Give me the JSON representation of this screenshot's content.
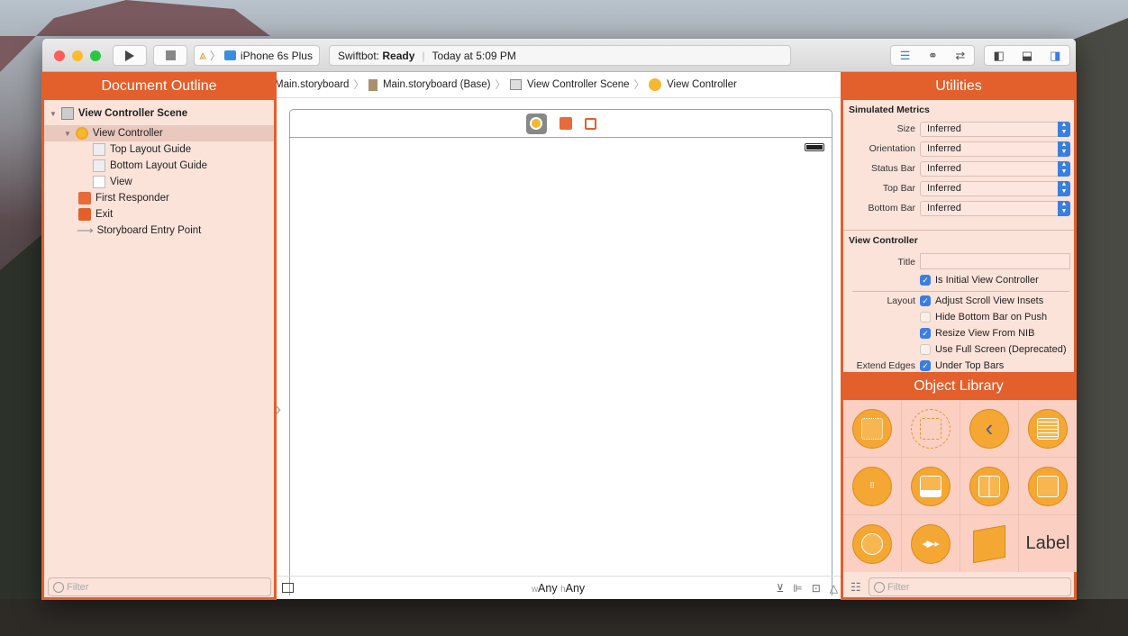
{
  "toolbar": {
    "scheme_device": "iPhone 6s Plus",
    "status_app": "Swiftbot:",
    "status_state": "Ready",
    "status_time": "Today at 5:09 PM"
  },
  "outline": {
    "title": "Document Outline",
    "items": [
      {
        "label": "View Controller Scene",
        "icon": "scene-icon"
      },
      {
        "label": "View Controller",
        "icon": "view-controller-icon"
      },
      {
        "label": "Top Layout Guide",
        "icon": "layout-guide-icon"
      },
      {
        "label": "Bottom Layout Guide",
        "icon": "layout-guide-icon"
      },
      {
        "label": "View",
        "icon": "view-icon"
      },
      {
        "label": "First Responder",
        "icon": "first-responder-icon"
      },
      {
        "label": "Exit",
        "icon": "exit-icon"
      },
      {
        "label": "Storyboard Entry Point",
        "icon": "arrow-right-icon"
      }
    ],
    "filter_placeholder": "Filter"
  },
  "breadcrumb": [
    "Main.storyboard",
    "Main.storyboard (Base)",
    "View Controller Scene",
    "View Controller"
  ],
  "canvas": {
    "w_prefix": "w",
    "w_value": "Any",
    "h_prefix": "h",
    "h_value": "Any"
  },
  "utilities": {
    "title": "Utilities",
    "simulated_metrics": {
      "heading": "Simulated Metrics",
      "rows": [
        {
          "label": "Size",
          "value": "Inferred"
        },
        {
          "label": "Orientation",
          "value": "Inferred"
        },
        {
          "label": "Status Bar",
          "value": "Inferred"
        },
        {
          "label": "Top Bar",
          "value": "Inferred"
        },
        {
          "label": "Bottom Bar",
          "value": "Inferred"
        }
      ]
    },
    "view_controller": {
      "heading": "View Controller",
      "title_label": "Title",
      "title_value": "",
      "initial": {
        "label": "Is Initial View Controller",
        "checked": true
      },
      "layout_label": "Layout",
      "layout": [
        {
          "label": "Adjust Scroll View Insets",
          "checked": true
        },
        {
          "label": "Hide Bottom Bar on Push",
          "checked": false
        },
        {
          "label": "Resize View From NIB",
          "checked": true
        },
        {
          "label": "Use Full Screen (Deprecated)",
          "checked": false
        }
      ],
      "extend_label": "Extend Edges",
      "extend": {
        "label": "Under Top Bars",
        "checked": true
      }
    }
  },
  "library": {
    "title": "Object Library",
    "label_item": "Label",
    "filter_placeholder": "Filter"
  },
  "colors": {
    "accent": "#e35f2c",
    "panel": "#fbe3da",
    "object": "#f5a733",
    "checkbox": "#3a7fe0"
  }
}
